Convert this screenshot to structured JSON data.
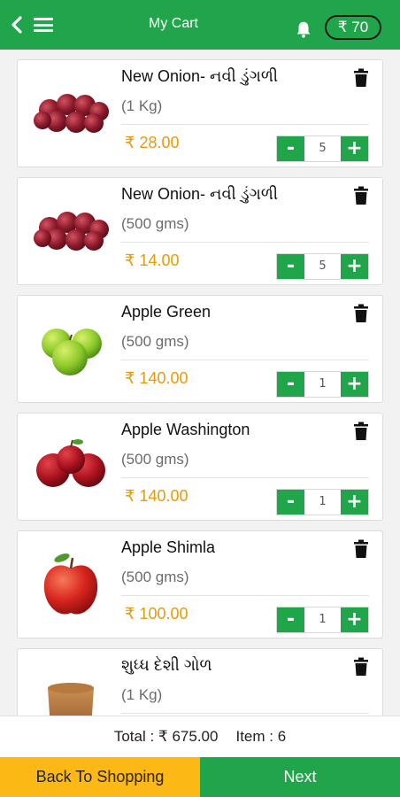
{
  "header": {
    "title": "My Cart",
    "wallet": "₹ 70",
    "icons": [
      "back-icon",
      "menu-icon",
      "bell-icon"
    ]
  },
  "items": [
    {
      "name": "New Onion- નવી ડુંગળી",
      "unit": "(1 Kg)",
      "price": "₹ 28.00",
      "qty": "5",
      "image": "red-onion"
    },
    {
      "name": "New Onion- નવી ડુંગળી",
      "unit": "(500 gms)",
      "price": "₹ 14.00",
      "qty": "5",
      "image": "red-onion"
    },
    {
      "name": "Apple Green",
      "unit": "(500 gms)",
      "price": "₹ 140.00",
      "qty": "1",
      "image": "green-apple"
    },
    {
      "name": "Apple Washington",
      "unit": "(500 gms)",
      "price": "₹ 140.00",
      "qty": "1",
      "image": "red-apple"
    },
    {
      "name": "Apple Shimla",
      "unit": "(500 gms)",
      "price": "₹ 100.00",
      "qty": "1",
      "image": "shimla-apple"
    },
    {
      "name": "શુધ્ધ દેશી ગોળ",
      "unit": "(1 Kg)",
      "price": "",
      "qty": "",
      "image": "jaggery"
    }
  ],
  "stepper": {
    "minus": "-",
    "plus": "+"
  },
  "summary": {
    "total": "Total : ₹ 675.00",
    "items": "Item : 6"
  },
  "footer": {
    "back_label": "Back To Shopping",
    "next_label": "Next"
  },
  "colors": {
    "primary": "#21a54a",
    "accent": "#fcb814",
    "price": "#e89a0c"
  }
}
